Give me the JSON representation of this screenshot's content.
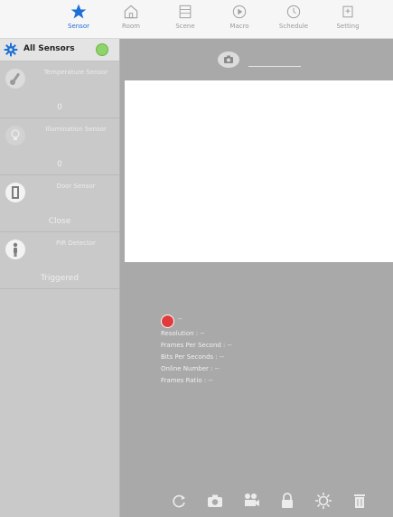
{
  "tabs": [
    {
      "label": "Sensor",
      "icon": "star-icon",
      "active": true
    },
    {
      "label": "Room",
      "icon": "home-icon",
      "active": false
    },
    {
      "label": "Scene",
      "icon": "scene-icon",
      "active": false
    },
    {
      "label": "Macro",
      "icon": "macro-icon",
      "active": false
    },
    {
      "label": "Schedule",
      "icon": "schedule-icon",
      "active": false
    },
    {
      "label": "Setting",
      "icon": "setting-icon",
      "active": false
    }
  ],
  "sidebar": {
    "title": "All Sensors",
    "items": [
      {
        "name": "Temperature Sensor",
        "value": "0",
        "icon": "thermometer-icon"
      },
      {
        "name": "Illumination Sensor",
        "value": "0",
        "icon": "bulb-icon"
      },
      {
        "name": "Door Sensor",
        "value": "Close",
        "icon": "door-icon"
      },
      {
        "name": "PIR Detector",
        "value": "Triggered",
        "icon": "person-icon"
      }
    ]
  },
  "camera": {
    "status": "--",
    "stats": [
      "Resolution : --",
      "Frames Per Second : --",
      "Bits Per Seconds : --",
      "Online Number : --",
      "Frames Ratio : --"
    ]
  },
  "colors": {
    "accent": "#1b6fd6",
    "sidebar_bg": "#c9c9c9",
    "main_bg": "#a9a9a9",
    "record_red": "#e23b3b",
    "online_green": "#8fd36b"
  }
}
